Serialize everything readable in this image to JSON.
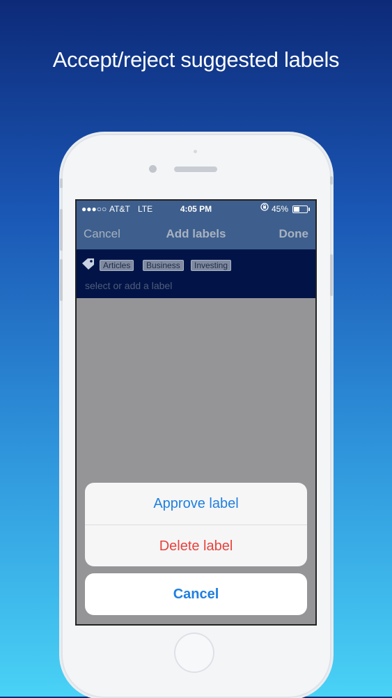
{
  "headline": "Accept/reject suggested labels",
  "status_bar": {
    "signal": "●●●○○",
    "carrier": "AT&T",
    "network": "LTE",
    "time": "4:05 PM",
    "battery_pct": "45%",
    "battery_level": 0.45
  },
  "navbar": {
    "cancel": "Cancel",
    "title": "Add labels",
    "done": "Done"
  },
  "labels": {
    "chips": [
      "Articles",
      "Business",
      "Investing"
    ],
    "placeholder": "select or add a label"
  },
  "action_sheet": {
    "approve": "Approve label",
    "delete": "Delete label",
    "cancel": "Cancel"
  },
  "icons": {
    "tag": "tag-icon",
    "lock": "rotation-lock-icon",
    "battery": "battery-icon"
  },
  "colors": {
    "accent": "#1f7fe0",
    "destructive": "#e8423b",
    "navbar": "#3e5f8d",
    "label_area": "#021447"
  }
}
